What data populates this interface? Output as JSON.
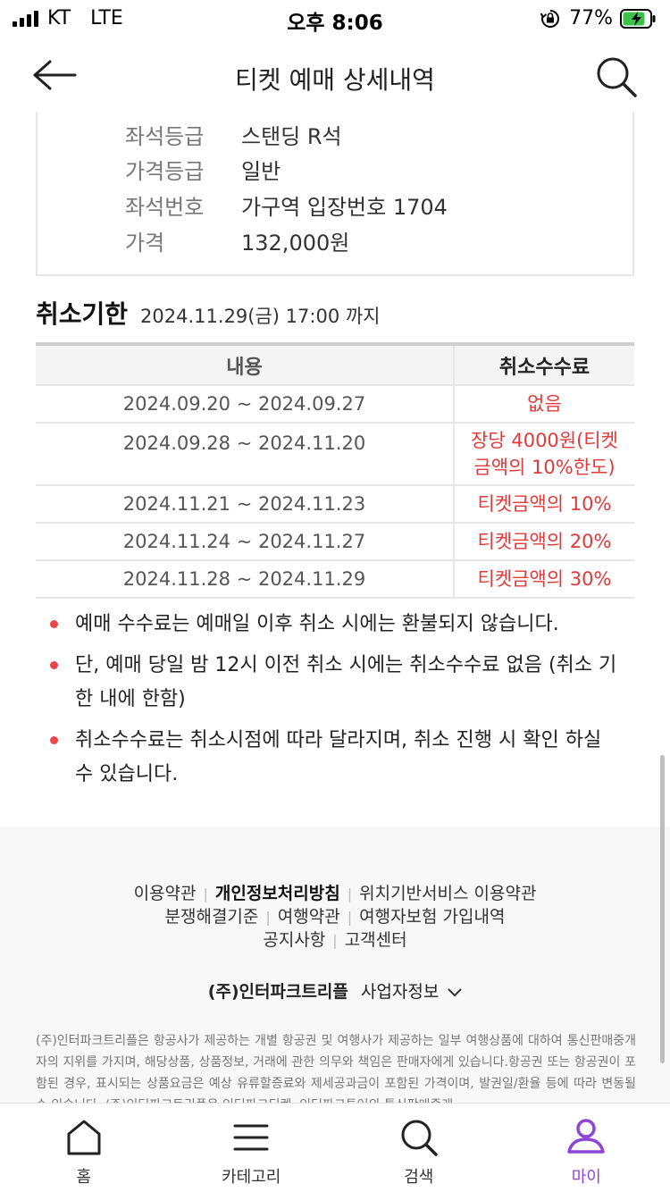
{
  "status_bar": {
    "carrier": "KT",
    "network": "LTE",
    "time": "오후 8:06",
    "battery": "77%"
  },
  "header": {
    "title": "티켓 예매 상세내역"
  },
  "ticket_info": [
    {
      "label": "좌석등급",
      "value": "스탠딩 R석"
    },
    {
      "label": "가격등급",
      "value": "일반"
    },
    {
      "label": "좌석번호",
      "value": "가구역 입장번호 1704"
    },
    {
      "label": "가격",
      "value": "132,000원"
    }
  ],
  "deadline": {
    "title": "취소기한",
    "date": "2024.11.29(금) 17:00 까지"
  },
  "fee_table": {
    "headers": [
      "내용",
      "취소수수료"
    ],
    "rows": [
      {
        "period": "2024.09.20 ~ 2024.09.27",
        "fee": "없음"
      },
      {
        "period": "2024.09.28 ~ 2024.11.20",
        "fee": "장당 4000원(티켓금액의 10%한도)"
      },
      {
        "period": "2024.11.21 ~ 2024.11.23",
        "fee": "티켓금액의 10%"
      },
      {
        "period": "2024.11.24 ~ 2024.11.27",
        "fee": "티켓금액의 20%"
      },
      {
        "period": "2024.11.28 ~ 2024.11.29",
        "fee": "티켓금액의 30%"
      }
    ]
  },
  "notices": [
    "예매 수수료는 예매일 이후 취소 시에는 환불되지 않습니다.",
    "단, 예매 당일 밤 12시 이전 취소 시에는 취소수수료 없음 (취소 기한 내에 한함)",
    "취소수수료는 취소시점에 따라 달라지며, 취소 진행 시 확인 하실 수 있습니다."
  ],
  "footer": {
    "links": {
      "terms": "이용약관",
      "privacy": "개인정보처리방침",
      "location_terms": "위치기반서비스 이용약관",
      "dispute": "분쟁해결기준",
      "travel_terms": "여행약관",
      "travel_insurance": "여행자보험 가입내역",
      "notice": "공지사항",
      "customer_center": "고객센터"
    },
    "company_name": "(주)인터파크트리플",
    "business_info": "사업자정보",
    "disclaimer": "(주)인터파크트리플은 항공사가 제공하는 개별 항공권 및 여행사가 제공하는 일부 여행상품에 대하여 통신판매중개자의 지위를 가지며, 해당상품, 상품정보, 거래에 관한 의무와 책임은 판매자에게 있습니다.항공권 또는 항공권이 포함된 경우, 표시되는 상품요금은 예상 유류할증료와 제세공과금이 포함된 가격이며, 발권일/환율 등에 따라 변동될 수 있습니다. (주)인터파크트리플은 인터파크티켓, 인터파크투어의 통신판매중개"
  },
  "bottom_nav": [
    {
      "label": "홈",
      "icon": "home-icon"
    },
    {
      "label": "카테고리",
      "icon": "menu-icon"
    },
    {
      "label": "검색",
      "icon": "search-icon"
    },
    {
      "label": "마이",
      "icon": "person-icon",
      "active": true
    }
  ],
  "colors": {
    "accent": "#8d46d6",
    "fee_red": "#e03a3a",
    "bullet_red": "#e8484a"
  }
}
